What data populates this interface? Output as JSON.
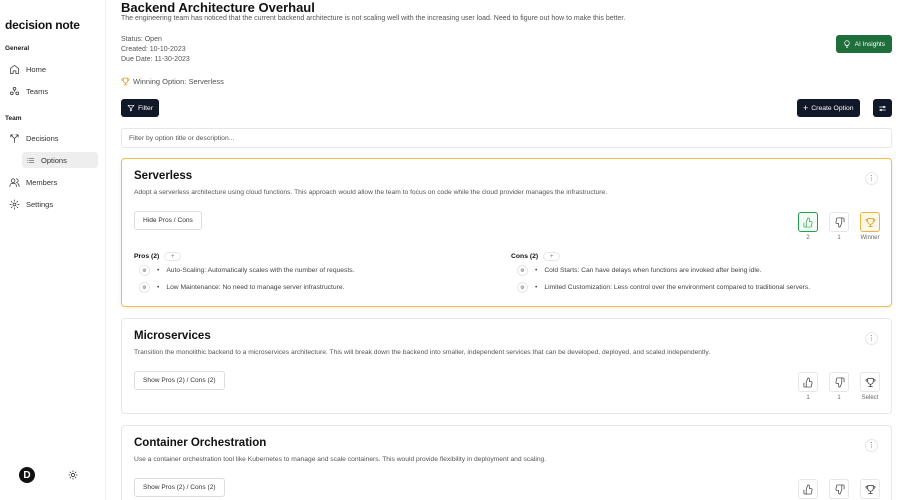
{
  "app": {
    "name": "decision note",
    "logo_letter": "D"
  },
  "sidebar": {
    "general_label": "General",
    "team_label": "Team",
    "items": [
      {
        "label": "Home",
        "icon": "home-icon"
      },
      {
        "label": "Teams",
        "icon": "teams-icon"
      },
      {
        "label": "Decisions",
        "icon": "decisions-icon"
      },
      {
        "label": "Options",
        "icon": "list-icon",
        "active": true
      },
      {
        "label": "Members",
        "icon": "members-icon"
      },
      {
        "label": "Settings",
        "icon": "gear-icon"
      }
    ]
  },
  "decision": {
    "title": "Backend Architecture Overhaul",
    "description": "The engineering team has noticed that the current backend architecture is not scaling well with the increasing user load. Need to figure out how to make this better.",
    "status": "Status: Open",
    "created": "Created: 10-10-2023",
    "due_date": "Due Date: 11-30-2023",
    "winning_option": "Winning Option: Serverless"
  },
  "toolbar": {
    "ai_insights_label": "AI Insights",
    "filter_label": "Filter",
    "create_option_label": "Create Option",
    "filter_placeholder": "Filter by option title or description..."
  },
  "options": [
    {
      "title": "Serverless",
      "description": "Adopt a serverless architecture using cloud functions. This approach would allow the team to focus on code while the cloud provider manages the infrastructure.",
      "toggle_label": "Hide Pros / Cons",
      "upvotes": "2",
      "downvotes": "1",
      "winner_label": "Winner",
      "pros_label": "Pros (2)",
      "cons_label": "Cons (2)",
      "pros": [
        "Auto-Scaling: Automatically scales with the number of requests.",
        "Low Maintenance: No need to manage server infrastructure."
      ],
      "cons": [
        "Cold Starts: Can have delays when functions are invoked after being idle.",
        "Limited Customization: Less control over the environment compared to traditional servers."
      ]
    },
    {
      "title": "Microservices",
      "description": "Transition the monolithic backend to a microservices architecture. This will break down the backend into smaller, independent services that can be developed, deployed, and scaled independently.",
      "toggle_label": "Show Pros (2) / Cons (2)",
      "upvotes": "1",
      "downvotes": "1",
      "winner_label": "Select"
    },
    {
      "title": "Container Orchestration",
      "description": "Use a container orchestration tool like Kubernetes to manage and scale containers. This would provide flexibility in deployment and scaling.",
      "toggle_label": "Show Pros (2) / Cons (2)"
    }
  ],
  "colors": {
    "primary_button": "#111827",
    "ai_button": "#1f6f3a",
    "winner_border": "#f0c04a",
    "upvote_active": "#22a04b"
  }
}
